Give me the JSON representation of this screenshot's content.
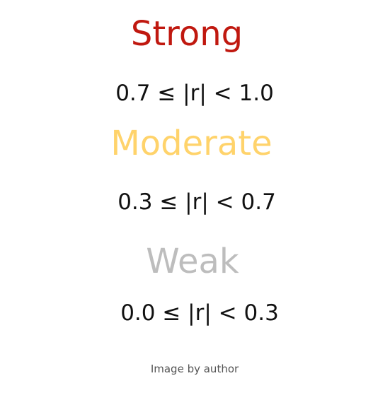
{
  "categories": [
    {
      "label": "Strong",
      "range": "0.7 ≤ |r| < 1.0",
      "color": "#c0180f"
    },
    {
      "label": "Moderate",
      "range": "0.3 ≤ |r| < 0.7",
      "color": "#ffd36b"
    },
    {
      "label": "Weak",
      "range": "0.0 ≤ |r| < 0.3",
      "color": "#bdbdbd"
    }
  ],
  "caption": "Image by author"
}
